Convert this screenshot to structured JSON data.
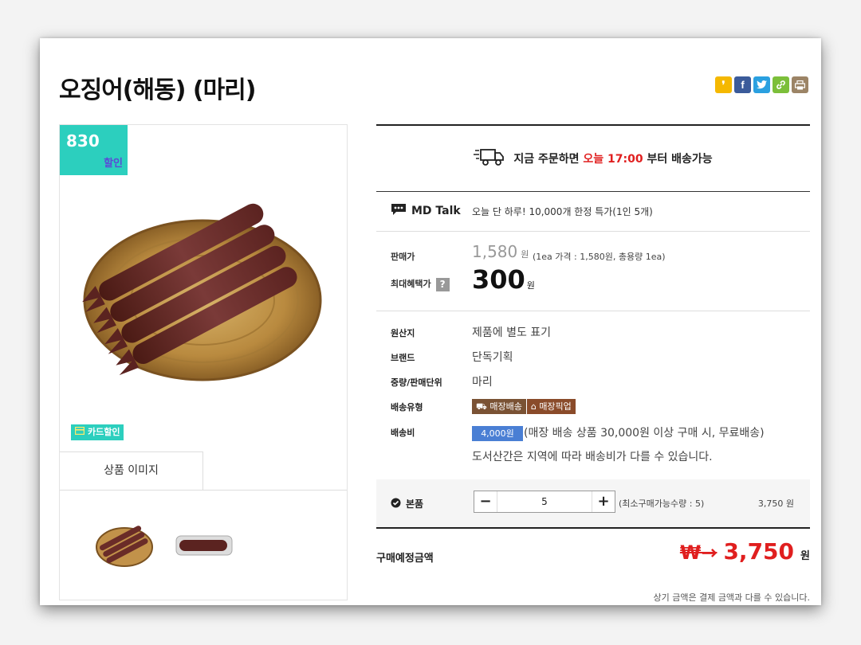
{
  "product": {
    "title": "오징어(해동) (마리)"
  },
  "share": {
    "icons": [
      "kakao-icon",
      "facebook-icon",
      "twitter-icon",
      "link-icon",
      "print-icon"
    ]
  },
  "image_panel": {
    "discount_number": "830",
    "discount_label": "할인",
    "card_tag": "카드할인",
    "tab_label": "상품 이미지"
  },
  "shipping": {
    "prefix": "지금 주문하면",
    "highlight": "오늘 17:00",
    "suffix": "부터 배송가능"
  },
  "md_talk": {
    "label": "MD Talk",
    "text": "오늘 단 하루! 10,000개 한정 특가(1인 5개)"
  },
  "price": {
    "sale_label": "판매가",
    "sale_value": "1,580",
    "sale_unit": "원",
    "sale_detail": "(1ea 가격 : 1,580원, 총용량 1ea)",
    "best_label": "최대혜택가",
    "best_help": "?",
    "best_value": "300",
    "best_unit": "원"
  },
  "specs": {
    "origin_label": "원산지",
    "origin_value": "제품에 별도 표기",
    "brand_label": "브랜드",
    "brand_value": "단독기획",
    "weight_label": "중량/판매단위",
    "weight_value": "마리",
    "delivery_type_label": "배송유형",
    "delivery_badge_1": "매장배송",
    "delivery_badge_2": "매장픽업",
    "fee_label": "배송비",
    "fee_badge": "4,000원",
    "fee_text": "(매장 배송 상품 30,000원 이상 구매 시, 무료배송)",
    "fee_note": "도서산간은 지역에 따라 배송비가 다를 수 있습니다."
  },
  "option": {
    "label": "본품",
    "minus": "−",
    "quantity": "5",
    "plus": "+",
    "min_qty": "(최소구매가능수량 : 5)",
    "price": "3,750 원"
  },
  "total": {
    "label": "구매예정금액",
    "currency": "₩→",
    "amount": "3,750",
    "unit": "원",
    "note": "상기 금액은 결제 금액과 다를 수 있습니다."
  },
  "colors": {
    "accent_teal": "#2ccfbe",
    "price_red": "#e01f1f",
    "fee_blue": "#4a7fd4",
    "badge_brown_1": "#7a5234",
    "badge_brown_2": "#8a4b2a"
  }
}
